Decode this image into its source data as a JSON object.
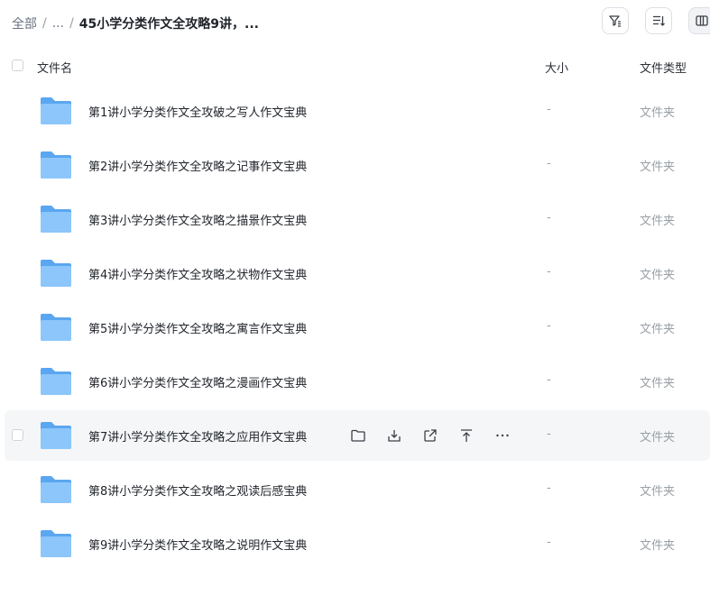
{
  "breadcrumb": {
    "root": "全部",
    "separator": "/",
    "ellipsis": "...",
    "current": "45小学分类作文全攻略9讲，..."
  },
  "toolbar": {
    "icons": [
      "filter-icon",
      "sort-icon",
      "view-columns-icon"
    ]
  },
  "table": {
    "headers": {
      "name": "文件名",
      "size": "大小",
      "type": "文件类型"
    },
    "rows": [
      {
        "name": "第1讲小学分类作文全攻破之写人作文宝典",
        "size": "-",
        "type": "文件夹"
      },
      {
        "name": "第2讲小学分类作文全攻略之记事作文宝典",
        "size": "-",
        "type": "文件夹"
      },
      {
        "name": "第3讲小学分类作文全攻略之描景作文宝典",
        "size": "-",
        "type": "文件夹"
      },
      {
        "name": "第4讲小学分类作文全攻略之状物作文宝典",
        "size": "-",
        "type": "文件夹"
      },
      {
        "name": "第5讲小学分类作文全攻略之寓言作文宝典",
        "size": "-",
        "type": "文件夹"
      },
      {
        "name": "第6讲小学分类作文全攻略之漫画作文宝典",
        "size": "-",
        "type": "文件夹"
      },
      {
        "name": "第7讲小学分类作文全攻略之应用作文宝典",
        "size": "-",
        "type": "文件夹"
      },
      {
        "name": "第8讲小学分类作文全攻略之观读后感宝典",
        "size": "-",
        "type": "文件夹"
      },
      {
        "name": "第9讲小学分类作文全攻略之说明作文宝典",
        "size": "-",
        "type": "文件夹"
      }
    ],
    "hovered_row": 6,
    "row_actions": [
      "open-folder-icon",
      "download-icon",
      "share-icon",
      "move-to-top-icon",
      "more-icon"
    ]
  },
  "colors": {
    "folder_back": "#5aa6f0",
    "folder_front": "#8cc6fb",
    "hover_bg": "#f5f6f7",
    "muted_text": "#9aa0a6"
  }
}
